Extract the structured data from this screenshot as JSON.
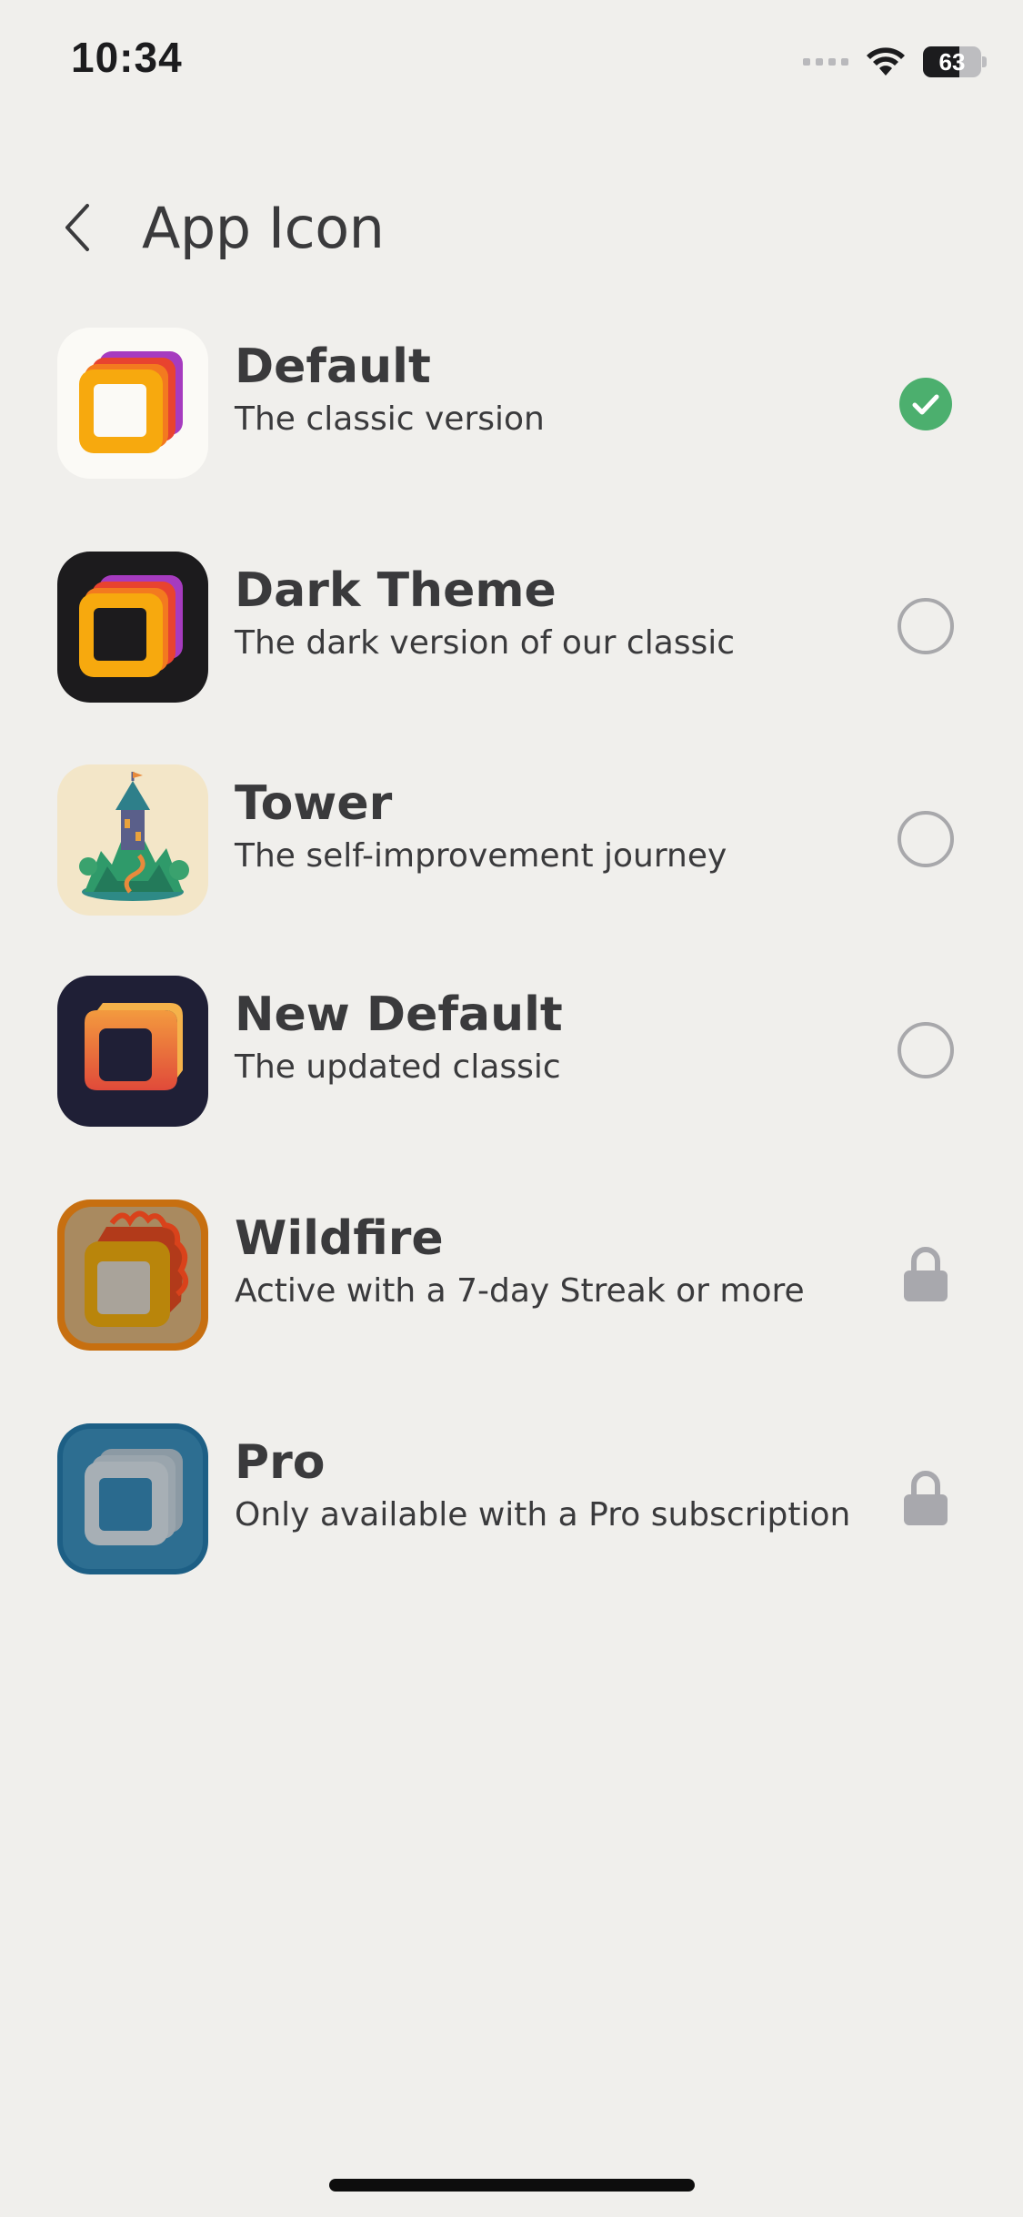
{
  "status_bar": {
    "time": "10:34",
    "battery_level": "63",
    "battery_fraction": 0.63
  },
  "header": {
    "back_icon": "chevron-left-icon",
    "title": "App Icon"
  },
  "icons": [
    {
      "title": "Default",
      "subtitle": "The classic version",
      "state": "selected",
      "control_icon": "checkmark-circle-icon"
    },
    {
      "title": "Dark Theme",
      "subtitle": "The dark version of our classic",
      "state": "unselected",
      "control_icon": "radio-empty-icon"
    },
    {
      "title": "Tower",
      "subtitle": "The self-improvement journey",
      "state": "unselected",
      "control_icon": "radio-empty-icon"
    },
    {
      "title": "New Default",
      "subtitle": "The updated classic",
      "state": "unselected",
      "control_icon": "radio-empty-icon"
    },
    {
      "title": "Wildfire",
      "subtitle": "Active with a 7-day Streak or more",
      "state": "locked",
      "control_icon": "lock-icon"
    },
    {
      "title": "Pro",
      "subtitle": "Only available with a Pro subscription",
      "state": "locked",
      "control_icon": "lock-icon"
    }
  ],
  "colors": {
    "background": "#f0efec",
    "selected_green": "#4caf6e",
    "radio_gray": "#a8a8ab",
    "lock_gray": "#a8a8ad",
    "text": "#3a3a3c"
  }
}
